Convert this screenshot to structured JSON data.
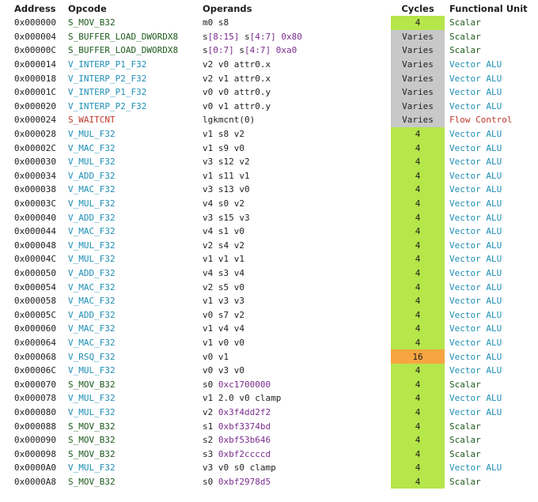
{
  "headers": {
    "address": "Address",
    "opcode": "Opcode",
    "operands": "Operands",
    "cycles": "Cycles",
    "unit": "Functional Unit"
  },
  "colors": {
    "cycles_fast": "#b5e64a",
    "cycles_varies": "#c8c8c8",
    "cycles_slow": "#f7a541",
    "scalar_text": "#1e5a1e",
    "valu_text": "#1f8fb5",
    "flow_text": "#c0392b",
    "immediate_text": "#7b2d8e"
  },
  "rows": [
    {
      "addr": "0x000000",
      "op": "S_MOV_B32",
      "cls": "scalar",
      "ops": [
        [
          "m0 s8",
          ""
        ]
      ],
      "cyc": "4",
      "cb": "fast",
      "unit": "Scalar"
    },
    {
      "addr": "0x000004",
      "op": "S_BUFFER_LOAD_DWORDX8",
      "cls": "scalar",
      "ops": [
        [
          "s",
          ""
        ],
        [
          "[8:15]",
          "imm"
        ],
        [
          " s",
          ""
        ],
        [
          "[4:7]",
          "imm"
        ],
        [
          " ",
          ""
        ],
        [
          "0x80",
          "imm"
        ]
      ],
      "cyc": "Varies",
      "cb": "varies",
      "unit": "Scalar"
    },
    {
      "addr": "0x00000C",
      "op": "S_BUFFER_LOAD_DWORDX8",
      "cls": "scalar",
      "ops": [
        [
          "s",
          ""
        ],
        [
          "[0:7]",
          "imm"
        ],
        [
          " s",
          ""
        ],
        [
          "[4:7]",
          "imm"
        ],
        [
          " ",
          ""
        ],
        [
          "0xa0",
          "imm"
        ]
      ],
      "cyc": "Varies",
      "cb": "varies",
      "unit": "Scalar"
    },
    {
      "addr": "0x000014",
      "op": "V_INTERP_P1_F32",
      "cls": "valu",
      "ops": [
        [
          "v2 v0 attr0.x",
          ""
        ]
      ],
      "cyc": "Varies",
      "cb": "varies",
      "unit": "Vector ALU"
    },
    {
      "addr": "0x000018",
      "op": "V_INTERP_P2_F32",
      "cls": "valu",
      "ops": [
        [
          "v2 v1 attr0.x",
          ""
        ]
      ],
      "cyc": "Varies",
      "cb": "varies",
      "unit": "Vector ALU"
    },
    {
      "addr": "0x00001C",
      "op": "V_INTERP_P1_F32",
      "cls": "valu",
      "ops": [
        [
          "v0 v0 attr0.y",
          ""
        ]
      ],
      "cyc": "Varies",
      "cb": "varies",
      "unit": "Vector ALU"
    },
    {
      "addr": "0x000020",
      "op": "V_INTERP_P2_F32",
      "cls": "valu",
      "ops": [
        [
          "v0 v1 attr0.y",
          ""
        ]
      ],
      "cyc": "Varies",
      "cb": "varies",
      "unit": "Vector ALU"
    },
    {
      "addr": "0x000024",
      "op": "S_WAITCNT",
      "cls": "flow",
      "ops": [
        [
          "lgkmcnt(0)",
          ""
        ]
      ],
      "cyc": "Varies",
      "cb": "varies",
      "unit": "Flow Control"
    },
    {
      "addr": "0x000028",
      "op": "V_MUL_F32",
      "cls": "valu",
      "ops": [
        [
          "v1 s8 v2",
          ""
        ]
      ],
      "cyc": "4",
      "cb": "fast",
      "unit": "Vector ALU"
    },
    {
      "addr": "0x00002C",
      "op": "V_MAC_F32",
      "cls": "valu",
      "ops": [
        [
          "v1 s9 v0",
          ""
        ]
      ],
      "cyc": "4",
      "cb": "fast",
      "unit": "Vector ALU"
    },
    {
      "addr": "0x000030",
      "op": "V_MUL_F32",
      "cls": "valu",
      "ops": [
        [
          "v3 s12 v2",
          ""
        ]
      ],
      "cyc": "4",
      "cb": "fast",
      "unit": "Vector ALU"
    },
    {
      "addr": "0x000034",
      "op": "V_ADD_F32",
      "cls": "valu",
      "ops": [
        [
          "v1 s11 v1",
          ""
        ]
      ],
      "cyc": "4",
      "cb": "fast",
      "unit": "Vector ALU"
    },
    {
      "addr": "0x000038",
      "op": "V_MAC_F32",
      "cls": "valu",
      "ops": [
        [
          "v3 s13 v0",
          ""
        ]
      ],
      "cyc": "4",
      "cb": "fast",
      "unit": "Vector ALU"
    },
    {
      "addr": "0x00003C",
      "op": "V_MUL_F32",
      "cls": "valu",
      "ops": [
        [
          "v4 s0 v2",
          ""
        ]
      ],
      "cyc": "4",
      "cb": "fast",
      "unit": "Vector ALU"
    },
    {
      "addr": "0x000040",
      "op": "V_ADD_F32",
      "cls": "valu",
      "ops": [
        [
          "v3 s15 v3",
          ""
        ]
      ],
      "cyc": "4",
      "cb": "fast",
      "unit": "Vector ALU"
    },
    {
      "addr": "0x000044",
      "op": "V_MAC_F32",
      "cls": "valu",
      "ops": [
        [
          "v4 s1 v0",
          ""
        ]
      ],
      "cyc": "4",
      "cb": "fast",
      "unit": "Vector ALU"
    },
    {
      "addr": "0x000048",
      "op": "V_MUL_F32",
      "cls": "valu",
      "ops": [
        [
          "v2 s4 v2",
          ""
        ]
      ],
      "cyc": "4",
      "cb": "fast",
      "unit": "Vector ALU"
    },
    {
      "addr": "0x00004C",
      "op": "V_MUL_F32",
      "cls": "valu",
      "ops": [
        [
          "v1 v1 v1",
          ""
        ]
      ],
      "cyc": "4",
      "cb": "fast",
      "unit": "Vector ALU"
    },
    {
      "addr": "0x000050",
      "op": "V_ADD_F32",
      "cls": "valu",
      "ops": [
        [
          "v4 s3 v4",
          ""
        ]
      ],
      "cyc": "4",
      "cb": "fast",
      "unit": "Vector ALU"
    },
    {
      "addr": "0x000054",
      "op": "V_MAC_F32",
      "cls": "valu",
      "ops": [
        [
          "v2 s5 v0",
          ""
        ]
      ],
      "cyc": "4",
      "cb": "fast",
      "unit": "Vector ALU"
    },
    {
      "addr": "0x000058",
      "op": "V_MAC_F32",
      "cls": "valu",
      "ops": [
        [
          "v1 v3 v3",
          ""
        ]
      ],
      "cyc": "4",
      "cb": "fast",
      "unit": "Vector ALU"
    },
    {
      "addr": "0x00005C",
      "op": "V_ADD_F32",
      "cls": "valu",
      "ops": [
        [
          "v0 s7 v2",
          ""
        ]
      ],
      "cyc": "4",
      "cb": "fast",
      "unit": "Vector ALU"
    },
    {
      "addr": "0x000060",
      "op": "V_MAC_F32",
      "cls": "valu",
      "ops": [
        [
          "v1 v4 v4",
          ""
        ]
      ],
      "cyc": "4",
      "cb": "fast",
      "unit": "Vector ALU"
    },
    {
      "addr": "0x000064",
      "op": "V_MAC_F32",
      "cls": "valu",
      "ops": [
        [
          "v1 v0 v0",
          ""
        ]
      ],
      "cyc": "4",
      "cb": "fast",
      "unit": "Vector ALU"
    },
    {
      "addr": "0x000068",
      "op": "V_RSQ_F32",
      "cls": "valu",
      "ops": [
        [
          "v0 v1",
          ""
        ]
      ],
      "cyc": "16",
      "cb": "slow",
      "unit": "Vector ALU"
    },
    {
      "addr": "0x00006C",
      "op": "V_MUL_F32",
      "cls": "valu",
      "ops": [
        [
          "v0 v3 v0",
          ""
        ]
      ],
      "cyc": "4",
      "cb": "fast",
      "unit": "Vector ALU"
    },
    {
      "addr": "0x000070",
      "op": "S_MOV_B32",
      "cls": "scalar",
      "ops": [
        [
          "s0 ",
          ""
        ],
        [
          "0xc1700000",
          "imm"
        ]
      ],
      "cyc": "4",
      "cb": "fast",
      "unit": "Scalar"
    },
    {
      "addr": "0x000078",
      "op": "V_MUL_F32",
      "cls": "valu",
      "ops": [
        [
          "v1 2.0 v0 clamp",
          ""
        ]
      ],
      "cyc": "4",
      "cb": "fast",
      "unit": "Vector ALU"
    },
    {
      "addr": "0x000080",
      "op": "V_MUL_F32",
      "cls": "valu",
      "ops": [
        [
          "v2 ",
          ""
        ],
        [
          "0x3f4dd2f2",
          "imm"
        ]
      ],
      "cyc": "4",
      "cb": "fast",
      "unit": "Vector ALU"
    },
    {
      "addr": "0x000088",
      "op": "S_MOV_B32",
      "cls": "scalar",
      "ops": [
        [
          "s1 ",
          ""
        ],
        [
          "0xbf3374bd",
          "imm"
        ]
      ],
      "cyc": "4",
      "cb": "fast",
      "unit": "Scalar"
    },
    {
      "addr": "0x000090",
      "op": "S_MOV_B32",
      "cls": "scalar",
      "ops": [
        [
          "s2 ",
          ""
        ],
        [
          "0xbf53b646",
          "imm"
        ]
      ],
      "cyc": "4",
      "cb": "fast",
      "unit": "Scalar"
    },
    {
      "addr": "0x000098",
      "op": "S_MOV_B32",
      "cls": "scalar",
      "ops": [
        [
          "s3 ",
          ""
        ],
        [
          "0xbf2ccccd",
          "imm"
        ]
      ],
      "cyc": "4",
      "cb": "fast",
      "unit": "Scalar"
    },
    {
      "addr": "0x0000A0",
      "op": "V_MUL_F32",
      "cls": "valu",
      "ops": [
        [
          "v3 v0 s0 clamp",
          ""
        ]
      ],
      "cyc": "4",
      "cb": "fast",
      "unit": "Vector ALU"
    },
    {
      "addr": "0x0000A8",
      "op": "S_MOV_B32",
      "cls": "scalar",
      "ops": [
        [
          "s0 ",
          ""
        ],
        [
          "0xbf2978d5",
          "imm"
        ]
      ],
      "cyc": "4",
      "cb": "fast",
      "unit": "Scalar"
    }
  ]
}
